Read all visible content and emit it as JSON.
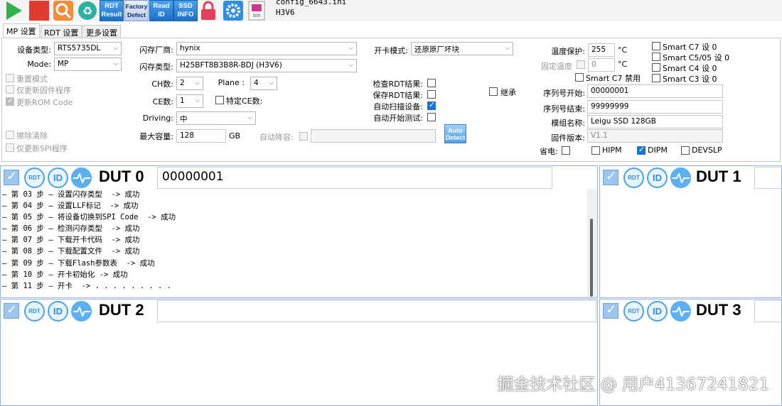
{
  "toolbar": {
    "rdt_result": "RDT\nResult",
    "factory_defect": "Factory\nDefect",
    "read_id": "Read\nID",
    "ssd_info": "SSD\nINFO",
    "bin_label": "bin",
    "config_name": "config_6643.ini",
    "chip_name": "H3V6"
  },
  "tabs": [
    "MP 设置",
    "RDT 设置",
    "更多设置"
  ],
  "settings": {
    "device_type_label": "设备类型:",
    "device_type": "RTS5735DL",
    "mode_label": "Mode:",
    "mode": "MP",
    "reset_mode": "重置模式",
    "update_fw_only": "仅更新固件程序",
    "update_rom": "更新ROM Code",
    "erase_clean": "擦除清除",
    "update_spi_only": "仅更新SPI程序",
    "flash_vendor_label": "闪存厂商:",
    "flash_vendor": "hynix",
    "flash_type_label": "闪存类型:",
    "flash_type": "H25BFT8B3B8R-BDJ (H3V6)",
    "ch_label": "CH数:",
    "ch": "2",
    "plane_label": "Plane :",
    "plane": "4",
    "ce_label": "CE数:",
    "ce": "1",
    "specific_ce": "特定CE数:",
    "driving_label": "Driving:",
    "driving": "中",
    "max_cap_label": "最大容量:",
    "max_cap": "128",
    "gb": "GB",
    "auto_derate": "自动降容:",
    "open_mode_label": "开卡模式:",
    "open_mode": "还原原厂坏块",
    "check_rdt": "检查RDT结果:",
    "save_rdt": "保存RDT结果:",
    "auto_scan": "自动扫描设备:",
    "auto_test": "自动开始测试:",
    "inherit": "继承",
    "auto_detect": "Auto\nDetect",
    "temp_protect_label": "温度保护:",
    "temp_protect": "255",
    "celsius": "°C",
    "fixed_temp_label": "固定温度",
    "fixed_temp": "0",
    "smart_c7_0": "Smart C7 设 0",
    "smart_c5_05_0": "Smart C5/05 设 0",
    "smart_c4_0": "Smart C4 设 0",
    "smart_c3_0": "Smart C3 设 0",
    "smart_c7_disable": "Smart C7 禁用",
    "serial_start_label": "序列号开始:",
    "serial_start": "00000001",
    "serial_end_label": "序列号结束:",
    "serial_end": "99999999",
    "model_label": "模组名称:",
    "model": "Leigu SSD 128GB",
    "fw_label": "固件版本:",
    "fw": "V1.1",
    "power_save_label": "省电:",
    "hipm": "HIPM",
    "dipm": "DIPM",
    "devslp": "DEVSLP"
  },
  "duts": [
    {
      "title": "DUT 0",
      "serial": "00000001"
    },
    {
      "title": "DUT 1",
      "serial": ""
    },
    {
      "title": "DUT 2",
      "serial": ""
    },
    {
      "title": "DUT 3",
      "serial": ""
    }
  ],
  "dut_icons": {
    "rdt": "RDT",
    "id": "ID"
  },
  "log_lines": [
    "— 第 03 步 — 设置闪存类型  -> 成功",
    "— 第 04 步 — 设置LLF标记  -> 成功",
    "— 第 05 步 — 将设备切换到SPI Code  -> 成功",
    "— 第 06 步 — 检测闪存类型  -> 成功",
    "— 第 07 步 — 下载开卡代码  -> 成功",
    "— 第 08 步 — 下载配置文件  -> 成功",
    "— 第 09 步 — 下载Flash参数表  -> 成功",
    "— 第 10 步 — 开卡初始化 -> 成功",
    "— 第 11 步 — 开卡  -> . . . . . . . . ."
  ],
  "watermark": "掘金技术社区 @ 用户41367241821",
  "colors": {
    "accent": "#1a73d9",
    "panel_border": "#8fb6e3",
    "lock": "#e0405a"
  }
}
